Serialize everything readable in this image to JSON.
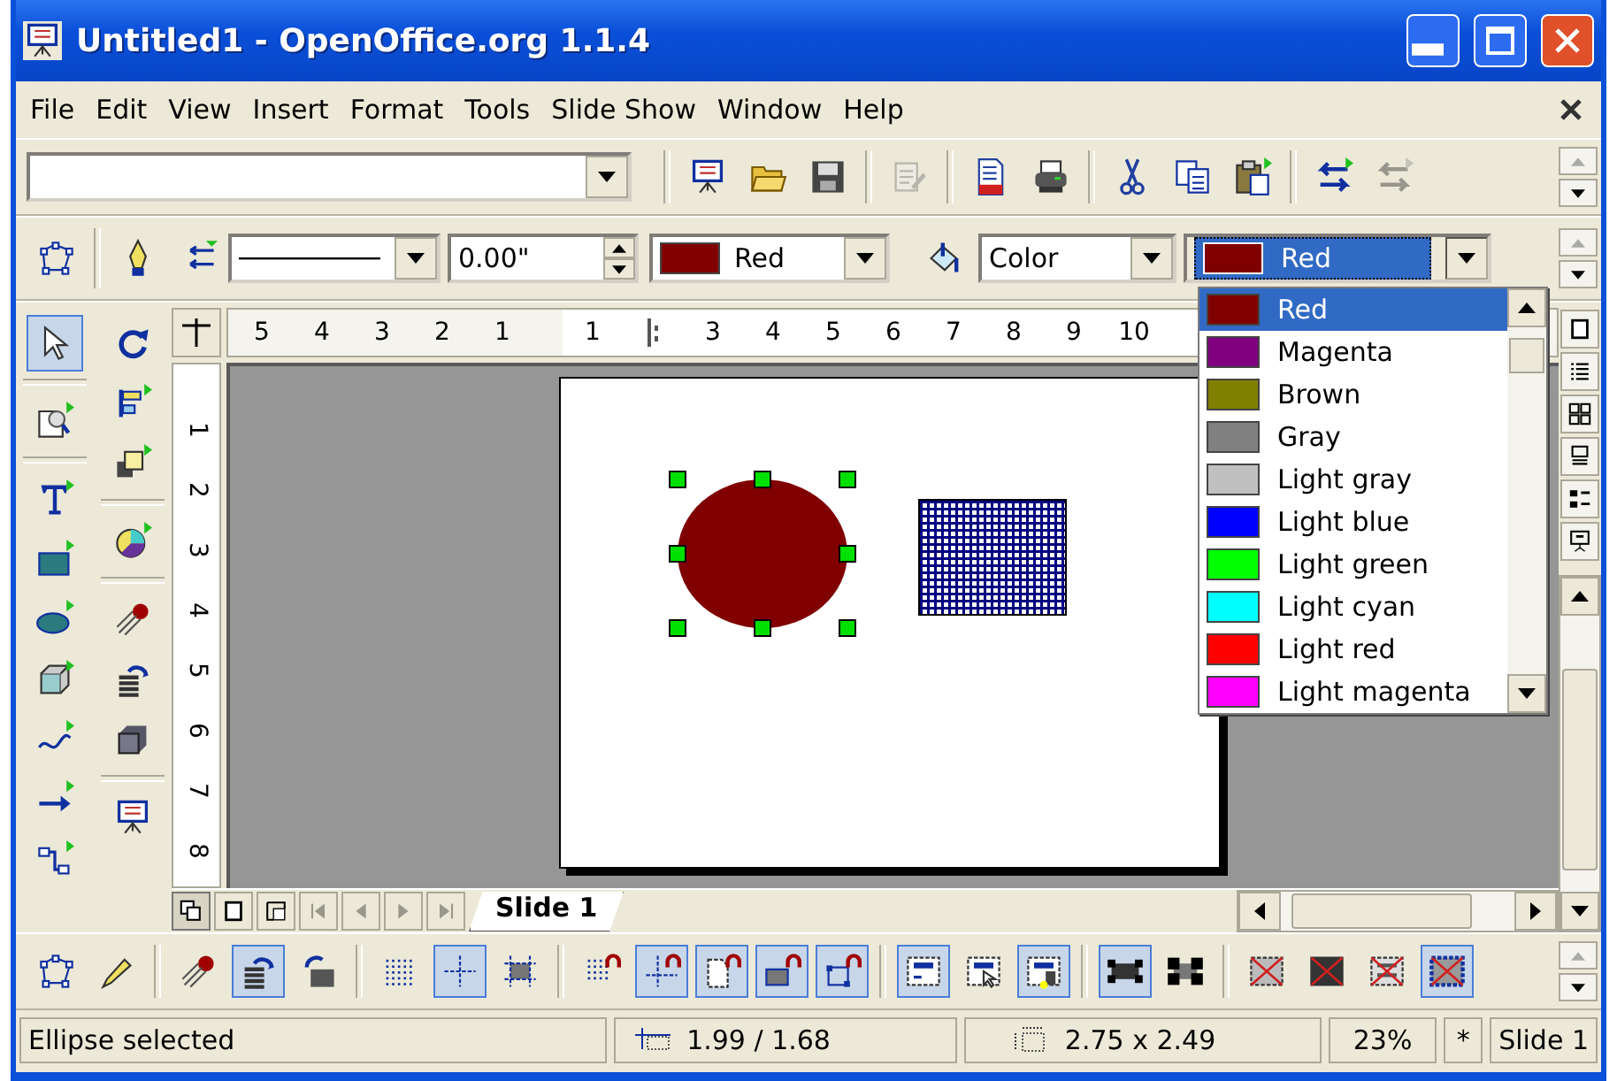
{
  "window": {
    "title": "Untitled1 - OpenOffice.org 1.1.4"
  },
  "menu": [
    "File",
    "Edit",
    "View",
    "Insert",
    "Format",
    "Tools",
    "Slide Show",
    "Window",
    "Help"
  ],
  "function_bar": {
    "buttons": [
      {
        "kind": "easel",
        "disabled": false
      },
      {
        "kind": "folder",
        "disabled": false
      },
      {
        "kind": "floppy",
        "disabled": false
      },
      {
        "kind": "separator"
      },
      {
        "kind": "edit-doc",
        "disabled": true
      },
      {
        "kind": "separator"
      },
      {
        "kind": "pdf-doc",
        "disabled": false
      },
      {
        "kind": "printer",
        "disabled": false
      },
      {
        "kind": "separator"
      },
      {
        "kind": "scissors",
        "disabled": false
      },
      {
        "kind": "copy",
        "disabled": false
      },
      {
        "kind": "clipboard",
        "disabled": false
      },
      {
        "kind": "separator"
      },
      {
        "kind": "swap-arrows",
        "disabled": false
      },
      {
        "kind": "swap-arrows",
        "disabled": true
      }
    ]
  },
  "object_bar": {
    "line_width": {
      "value": "0.00\""
    },
    "line_color": {
      "label": "Red",
      "color": "#800000"
    },
    "area_style": {
      "value": "Color"
    },
    "fill_color": {
      "label": "Red",
      "color": "#800000",
      "expanded": true
    }
  },
  "color_list": [
    {
      "label": "Red",
      "color": "#800000",
      "selected": true
    },
    {
      "label": "Magenta",
      "color": "#800080",
      "selected": false
    },
    {
      "label": "Brown",
      "color": "#808000",
      "selected": false
    },
    {
      "label": "Gray",
      "color": "#808080",
      "selected": false
    },
    {
      "label": "Light gray",
      "color": "#c0c0c0",
      "selected": false
    },
    {
      "label": "Light blue",
      "color": "#0000ff",
      "selected": false
    },
    {
      "label": "Light green",
      "color": "#00ff00",
      "selected": false
    },
    {
      "label": "Light cyan",
      "color": "#00ffff",
      "selected": false
    },
    {
      "label": "Light red",
      "color": "#ff0000",
      "selected": false
    },
    {
      "label": "Light magenta",
      "color": "#ff00ff",
      "selected": false
    }
  ],
  "drawing_toolbar": [
    [
      {
        "kind": "pointer",
        "selected": true
      },
      {
        "kind": "separator"
      },
      {
        "kind": "zoom-page",
        "selected": false
      },
      {
        "kind": "separator"
      },
      {
        "kind": "text-t",
        "selected": false
      },
      {
        "kind": "rect-shape",
        "selected": false
      },
      {
        "kind": "ellipse-shape",
        "selected": false
      },
      {
        "kind": "box-3d",
        "selected": false
      },
      {
        "kind": "curve",
        "selected": false
      },
      {
        "kind": "arrow-line",
        "selected": false
      },
      {
        "kind": "connector",
        "selected": false
      }
    ],
    [
      {
        "kind": "rotate",
        "selected": false
      },
      {
        "kind": "align",
        "selected": false
      },
      {
        "kind": "arrange",
        "selected": false
      },
      {
        "kind": "separator"
      },
      {
        "kind": "pie",
        "selected": false
      },
      {
        "kind": "separator"
      },
      {
        "kind": "meteor",
        "selected": false
      },
      {
        "kind": "stack-arrow",
        "selected": false
      },
      {
        "kind": "solid-cube",
        "selected": false
      },
      {
        "kind": "separator"
      },
      {
        "kind": "easel",
        "selected": false
      }
    ]
  ],
  "h_ruler": {
    "outside": [
      "5",
      "4",
      "3",
      "2",
      "1"
    ],
    "inside": [
      {
        "kind": "label",
        "text": "1"
      },
      {
        "kind": "marker"
      },
      {
        "kind": "label",
        "text": "3"
      },
      {
        "kind": "label",
        "text": "4"
      },
      {
        "kind": "label",
        "text": "5"
      },
      {
        "kind": "label",
        "text": "6"
      },
      {
        "kind": "label",
        "text": "7"
      },
      {
        "kind": "label",
        "text": "8"
      },
      {
        "kind": "label",
        "text": "9"
      },
      {
        "kind": "label",
        "text": "10"
      }
    ]
  },
  "v_ruler": [
    "1",
    "2",
    "3",
    "4",
    "5",
    "6",
    "7",
    "8"
  ],
  "slide": {
    "shapes": [
      {
        "kind": "ellipse",
        "color": "#800000",
        "selected": true
      },
      {
        "kind": "grid-rectangle",
        "color": "#000080",
        "selected": false
      }
    ]
  },
  "right_toolbar": [
    {
      "kind": "single-frame"
    },
    {
      "kind": "list-lines"
    },
    {
      "kind": "four-squares"
    },
    {
      "kind": "notes-page"
    },
    {
      "kind": "handout"
    },
    {
      "kind": "projector"
    }
  ],
  "view_buttons": [
    {
      "kind": "two-frames",
      "selected": true
    },
    {
      "kind": "single-frame",
      "selected": false
    },
    {
      "kind": "layered-frame",
      "selected": false
    }
  ],
  "nav_buttons": [
    {
      "kind": "first",
      "disabled": true
    },
    {
      "kind": "prev",
      "disabled": true
    },
    {
      "kind": "next",
      "disabled": true
    },
    {
      "kind": "last",
      "disabled": true
    }
  ],
  "slide_tabs": [
    {
      "label": "Slide 1",
      "selected": true
    }
  ],
  "options_bar": [
    {
      "kind": "edit-points",
      "selected": false
    },
    {
      "kind": "glue-pen",
      "selected": false
    },
    {
      "kind": "separator"
    },
    {
      "kind": "meteor",
      "selected": false
    },
    {
      "kind": "stack-arrow",
      "selected": true
    },
    {
      "kind": "rotate-bar",
      "selected": false
    },
    {
      "kind": "separator"
    },
    {
      "kind": "grid-dots",
      "selected": false
    },
    {
      "kind": "helplines",
      "selected": true
    },
    {
      "kind": "helplines-frame",
      "selected": false
    },
    {
      "kind": "separator"
    },
    {
      "kind": "snap-dots",
      "selected": false
    },
    {
      "kind": "snap-lines",
      "selected": true
    },
    {
      "kind": "snap-page",
      "selected": true
    },
    {
      "kind": "snap-frame",
      "selected": true
    },
    {
      "kind": "snap-points",
      "selected": true
    },
    {
      "kind": "separator"
    },
    {
      "kind": "text-box",
      "selected": true
    },
    {
      "kind": "text-pointer",
      "selected": false
    },
    {
      "kind": "text-hand",
      "selected": true
    },
    {
      "kind": "separator"
    },
    {
      "kind": "handles-small",
      "selected": true
    },
    {
      "kind": "handles-large",
      "selected": false
    },
    {
      "kind": "separator"
    },
    {
      "kind": "crossed-picture",
      "selected": false
    },
    {
      "kind": "crossed-fill",
      "selected": false
    },
    {
      "kind": "crossed-text",
      "selected": false
    },
    {
      "kind": "crossed-outline",
      "selected": true
    }
  ],
  "status_bar": {
    "message": "Ellipse selected",
    "position": "1.99 / 1.68",
    "size": "2.75 x 2.49",
    "zoom": "23%",
    "modified": "*",
    "page": "Slide 1"
  }
}
